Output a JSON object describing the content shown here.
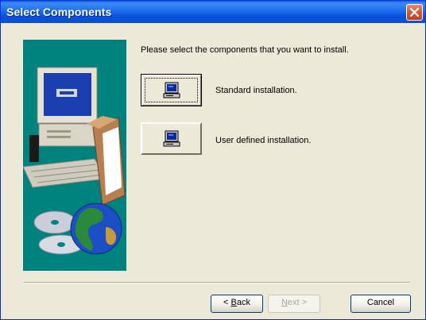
{
  "window": {
    "title": "Select Components"
  },
  "prompt": "Please select the components that you want to install.",
  "options": [
    {
      "label": "Standard installation."
    },
    {
      "label": "User defined installation."
    }
  ],
  "buttons": {
    "back": {
      "prefix": "< ",
      "mnemonic": "B",
      "rest": "ack"
    },
    "next": {
      "mnemonic": "N",
      "rest": "ext >"
    },
    "cancel": "Cancel"
  },
  "icons": {
    "close": "close-icon",
    "option": "computer-icon",
    "illustration": "computer-and-globe-illustration"
  },
  "colors": {
    "titlebar": "#0a5fdc",
    "illustration_bg": "#00827e",
    "close": "#d65b3c",
    "dialog": "#ece9d8"
  }
}
